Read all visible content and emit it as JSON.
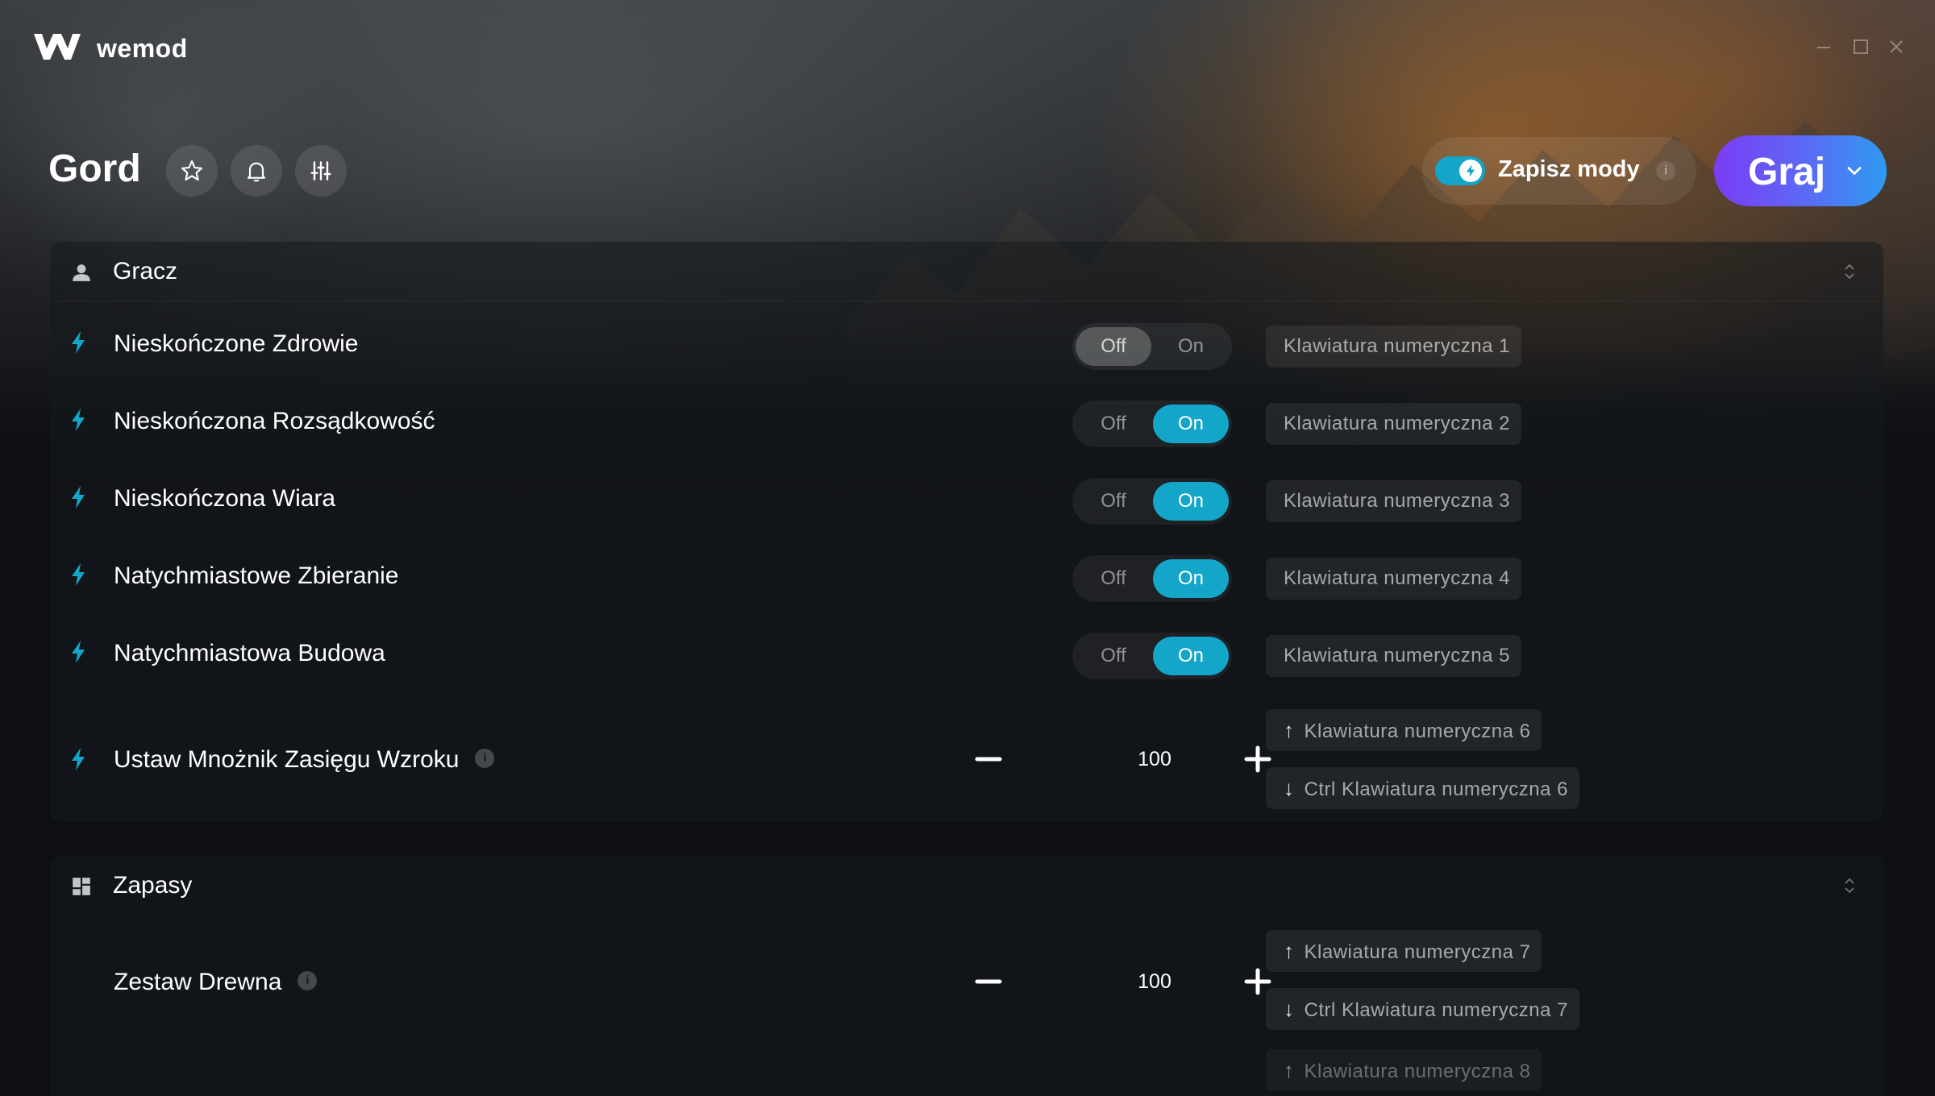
{
  "app": {
    "name": "wemod",
    "window_controls": [
      "minimize",
      "maximize",
      "close"
    ]
  },
  "header": {
    "game_title": "Gord",
    "icons": [
      "star-icon",
      "bell-icon",
      "sliders-icon"
    ],
    "save_mods": {
      "label": "Zapisz mody",
      "enabled": true,
      "info": "i"
    },
    "play_button": {
      "label": "Graj"
    }
  },
  "colors": {
    "accent": "#13a6c9",
    "play_gradient_start": "#7a3cf5",
    "play_gradient_end": "#2e9bf2"
  },
  "sections": [
    {
      "title": "Gracz",
      "icon": "user-icon",
      "mods": [
        {
          "name": "Nieskończone Zdrowie",
          "type": "toggle",
          "off_label": "Off",
          "on_label": "On",
          "value": "Off",
          "hotkey": "Klawiatura numeryczna 1"
        },
        {
          "name": "Nieskończona Rozsądkowość",
          "type": "toggle",
          "off_label": "Off",
          "on_label": "On",
          "value": "On",
          "hotkey": "Klawiatura numeryczna 2"
        },
        {
          "name": "Nieskończona Wiara",
          "type": "toggle",
          "off_label": "Off",
          "on_label": "On",
          "value": "On",
          "hotkey": "Klawiatura numeryczna 3"
        },
        {
          "name": "Natychmiastowe Zbieranie",
          "type": "toggle",
          "off_label": "Off",
          "on_label": "On",
          "value": "On",
          "hotkey": "Klawiatura numeryczna 4"
        },
        {
          "name": "Natychmiastowa Budowa",
          "type": "toggle",
          "off_label": "Off",
          "on_label": "On",
          "value": "On",
          "hotkey": "Klawiatura numeryczna 5"
        },
        {
          "name": "Ustaw Mnożnik Zasięgu Wzroku",
          "type": "stepper",
          "value": "100",
          "info": "i",
          "hotkey_up": "Klawiatura numeryczna 6",
          "hotkey_down": "Ctrl Klawiatura numeryczna 6"
        }
      ]
    },
    {
      "title": "Zapasy",
      "icon": "grid-icon",
      "mods": [
        {
          "name": "Zestaw Drewna",
          "type": "stepper",
          "value": "100",
          "info": "i",
          "hotkey_up": "Klawiatura numeryczna 7",
          "hotkey_down": "Ctrl Klawiatura numeryczna 7",
          "hotkey_next": "Klawiatura numeryczna 8"
        }
      ]
    }
  ]
}
